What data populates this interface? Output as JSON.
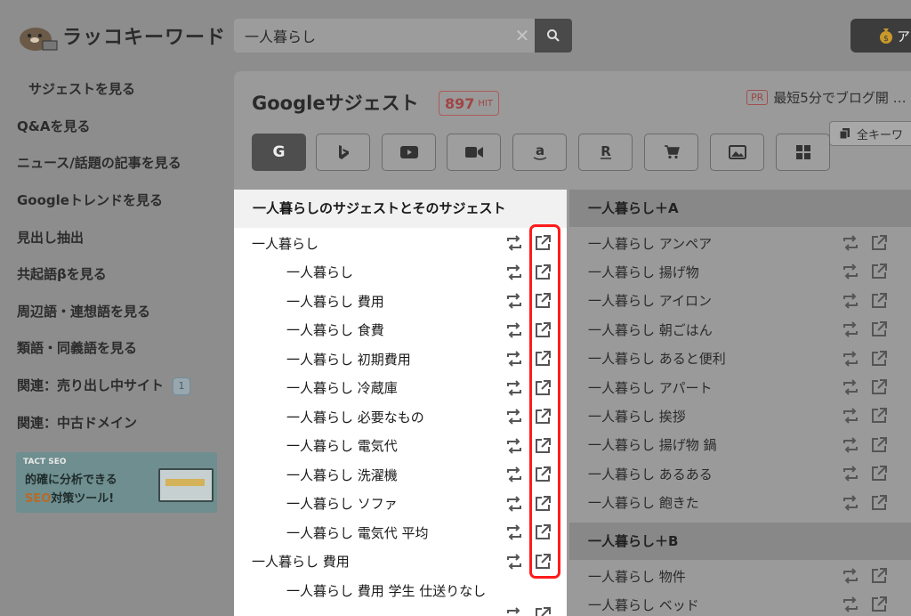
{
  "header": {
    "logo_text": "ラッコキーワード",
    "search_value": "一人暮らし",
    "top_button_label": "ア"
  },
  "sidebar": {
    "items": [
      {
        "label": "サジェストを見る",
        "active": true
      },
      {
        "label": "Q&Aを見る"
      },
      {
        "label": "ニュース/話題の記事を見る"
      },
      {
        "label": "Googleトレンドを見る"
      },
      {
        "label": "見出し抽出"
      },
      {
        "label": "共起語βを見る"
      },
      {
        "label": "周辺語・連想語を見る"
      },
      {
        "label": "類語・同義語を見る"
      },
      {
        "label": "関連：売り出し中サイト",
        "badge": "1"
      },
      {
        "label": "関連：中古ドメイン"
      }
    ],
    "ad": {
      "brand": "TACT SEO",
      "line1": "的確に分析できる",
      "line2_accent": "SEO",
      "line2_rest": "対策ツール!"
    }
  },
  "panel": {
    "title": "Googleサジェスト",
    "hit_count": "897",
    "hit_unit": "HIT",
    "pr_tag": "PR",
    "pr_text": "最短5分でブログ開 …",
    "copy_button": "全キーワ",
    "engines": [
      {
        "name": "google",
        "icon": "G"
      },
      {
        "name": "bing",
        "icon": "b"
      },
      {
        "name": "youtube",
        "icon": "play"
      },
      {
        "name": "video",
        "icon": "camera"
      },
      {
        "name": "amazon",
        "icon": "a"
      },
      {
        "name": "rakuten",
        "icon": "R"
      },
      {
        "name": "shopping",
        "icon": "cart"
      },
      {
        "name": "image",
        "icon": "picture"
      },
      {
        "name": "app",
        "icon": "grid"
      }
    ]
  },
  "left_list": {
    "header": "一人暮らしのサジェストとそのサジェスト",
    "rows": [
      {
        "text": "一人暮らし",
        "level": 0
      },
      {
        "text": "一人暮らし",
        "level": 1
      },
      {
        "text": "一人暮らし 費用",
        "level": 1
      },
      {
        "text": "一人暮らし 食費",
        "level": 1
      },
      {
        "text": "一人暮らし 初期費用",
        "level": 1
      },
      {
        "text": "一人暮らし 冷蔵庫",
        "level": 1
      },
      {
        "text": "一人暮らし 必要なもの",
        "level": 1
      },
      {
        "text": "一人暮らし 電気代",
        "level": 1
      },
      {
        "text": "一人暮らし 洗濯機",
        "level": 1
      },
      {
        "text": "一人暮らし ソファ",
        "level": 1
      },
      {
        "text": "一人暮らし 電気代 平均",
        "level": 1
      },
      {
        "text": "一人暮らし 費用",
        "level": 0
      },
      {
        "text": "一人暮らし 費用 学生 仕送りなし",
        "level": 1
      }
    ]
  },
  "right_list": {
    "groups": [
      {
        "header": "一人暮らし＋A",
        "rows": [
          "一人暮らし アンペア",
          "一人暮らし 揚げ物",
          "一人暮らし アイロン",
          "一人暮らし 朝ごはん",
          "一人暮らし あると便利",
          "一人暮らし アパート",
          "一人暮らし 挨拶",
          "一人暮らし 揚げ物 鍋",
          "一人暮らし あるある",
          "一人暮らし 飽きた"
        ]
      },
      {
        "header": "一人暮らし＋B",
        "rows": [
          "一人暮らし 物件",
          "一人暮らし ベッド"
        ]
      }
    ]
  },
  "colors": {
    "overlay": "#8d8d8d",
    "highlight": "#ff1a1a",
    "hit_red": "#a04545"
  }
}
